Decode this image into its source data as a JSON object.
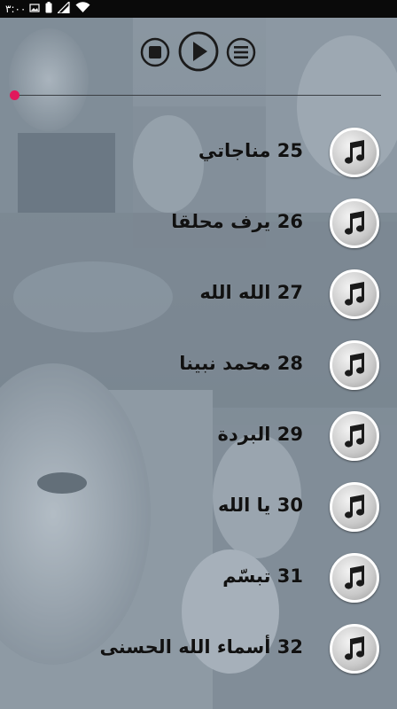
{
  "status_bar": {
    "time": "٣:٠٠",
    "icons": [
      "image-icon",
      "battery-icon",
      "signal-icon",
      "wifi-icon"
    ]
  },
  "player": {
    "stop_icon": "stop-icon",
    "play_icon": "play-icon",
    "menu_icon": "list-menu-icon",
    "progress": 0.0
  },
  "tracks": [
    {
      "label": "25 مناجاتي",
      "icon": "music-note-icon"
    },
    {
      "label": "26 يرف محلقا",
      "icon": "music-note-icon"
    },
    {
      "label": "27 الله الله",
      "icon": "music-note-icon"
    },
    {
      "label": "28 محمد نبينا",
      "icon": "music-note-icon"
    },
    {
      "label": "29 البردة",
      "icon": "music-note-icon"
    },
    {
      "label": "30 يا الله",
      "icon": "music-note-icon"
    },
    {
      "label": "31 تبسّم",
      "icon": "music-note-icon"
    },
    {
      "label": "32 أسماء الله الحسنى",
      "icon": "music-note-icon"
    }
  ],
  "colors": {
    "accent": "#e0195c",
    "overlay": "#8c98a3"
  }
}
